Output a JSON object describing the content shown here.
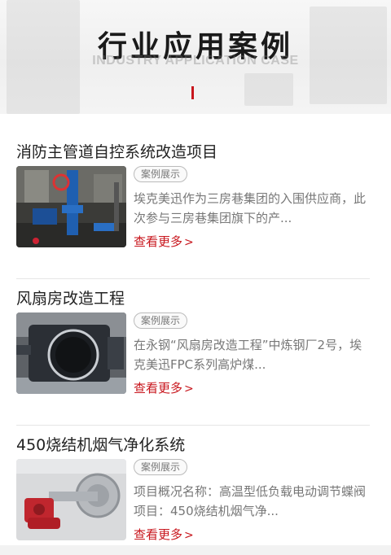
{
  "hero": {
    "title": "行业应用案例",
    "subtitle": "INDUSTRY APPLICATION CASE"
  },
  "cases": [
    {
      "title": "消防主管道自控系统改造项目",
      "tag": "案例展示",
      "description": "埃克美迅作为三房巷集团的入围供应商，此次参与三房巷集团旗下的产...",
      "more": "查看更多"
    },
    {
      "title": "风扇房改造工程",
      "tag": "案例展示",
      "description": "在永钢“风扇房改造工程”中炼钢厂2号，埃克美迅FPC系列高炉煤...",
      "more": "查看更多"
    },
    {
      "title": "450烧结机烟气净化系统",
      "tag": "案例展示",
      "description": "项目概况名称：高温型低负载电动调节蝶阀项目：450烧结机烟气净...",
      "more": "查看更多"
    }
  ],
  "icons": {
    "more": "chevron-right-icon"
  },
  "colors": {
    "accent": "#c8161d",
    "tag_border": "#bbbbbb",
    "text_muted": "#777777"
  }
}
